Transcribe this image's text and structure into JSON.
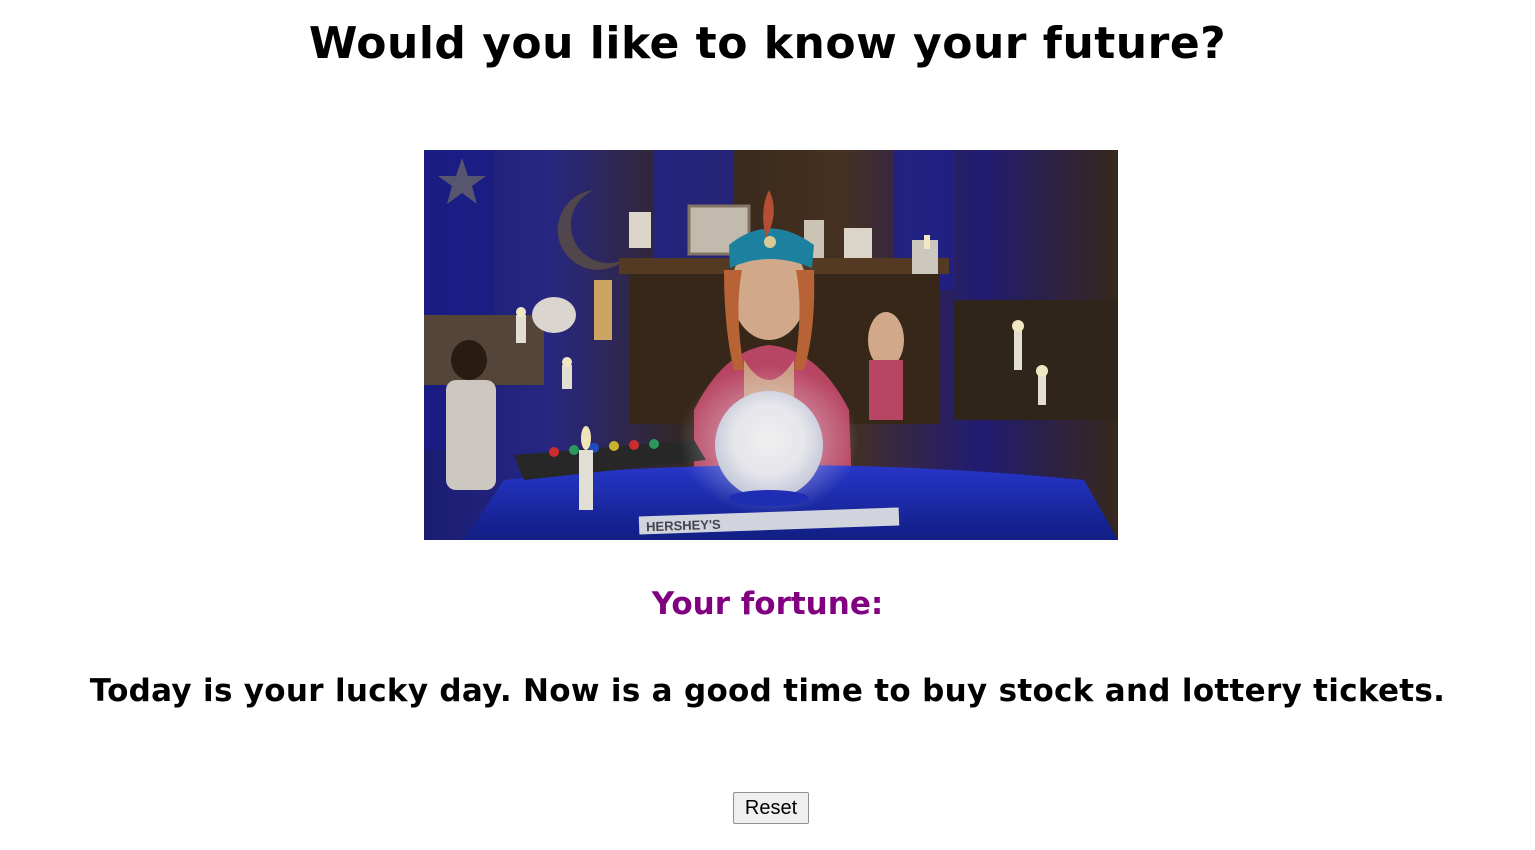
{
  "page": {
    "heading": "Would you like to know your future?",
    "fortune_label": "Your fortune:",
    "fortune_text": "Today is your lucky day. Now is a good time to buy stock and lottery tickets.",
    "reset_label": "Reset"
  },
  "image": {
    "alt": "fortune teller gif",
    "prop_text": "HERSHEY'S"
  },
  "colors": {
    "heading": "#000000",
    "fortune_label": "#800080",
    "fortune_text": "#000000",
    "background": "#ffffff"
  }
}
